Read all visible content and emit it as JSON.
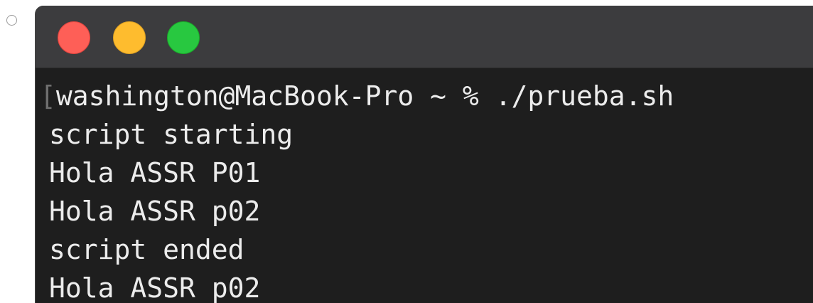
{
  "window": {
    "controls": {
      "close": "close-button",
      "minimize": "minimize-button",
      "zoom": "zoom-button"
    }
  },
  "terminal": {
    "prompt_bracket": "[",
    "prompt": "washington@MacBook-Pro ~ % ./prueba.sh",
    "output": [
      "script starting",
      "Hola ASSR P01",
      "Hola ASSR p02",
      "script ended",
      "Hola ASSR p02"
    ]
  },
  "colors": {
    "close": "#fe5f57",
    "minimize": "#febc2e",
    "zoom": "#28c840",
    "terminal_bg": "#1e1e1e",
    "titlebar_bg": "#3c3c3e",
    "text": "#ececec"
  }
}
